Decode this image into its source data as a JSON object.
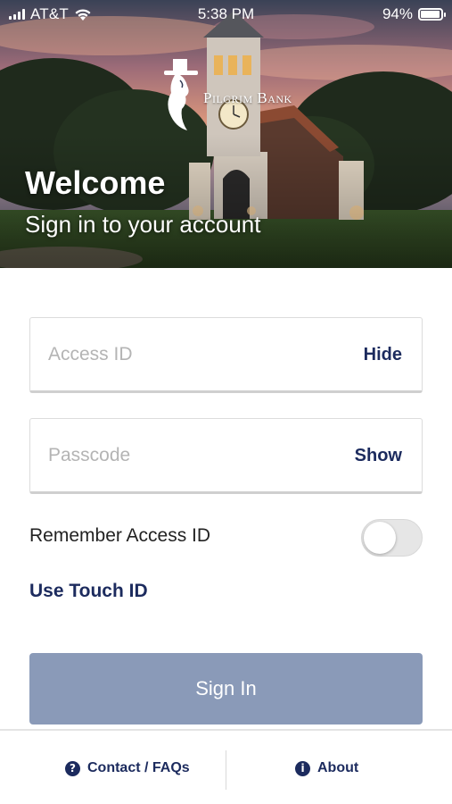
{
  "status_bar": {
    "carrier": "AT&T",
    "time": "5:38 PM",
    "battery_percent": "94%",
    "battery_level": 0.94,
    "icons": [
      "signal-icon",
      "wifi-icon",
      "battery-icon"
    ]
  },
  "hero": {
    "logo_text": "Pilgrim Bank",
    "title": "Welcome",
    "subtitle": "Sign in to your account"
  },
  "form": {
    "access_id": {
      "placeholder": "Access ID",
      "value": "",
      "action": "Hide"
    },
    "passcode": {
      "placeholder": "Passcode",
      "value": "",
      "action": "Show"
    },
    "remember_label": "Remember Access ID",
    "remember_enabled": false,
    "touch_id_label": "Use Touch ID",
    "sign_in_label": "Sign In"
  },
  "footer": {
    "contact_label": "Contact / FAQs",
    "contact_icon": "question-circle-icon",
    "about_label": "About",
    "about_icon": "info-circle-icon"
  },
  "colors": {
    "brand_navy": "#1c2b5e",
    "button_disabled": "#8a9ab8"
  }
}
